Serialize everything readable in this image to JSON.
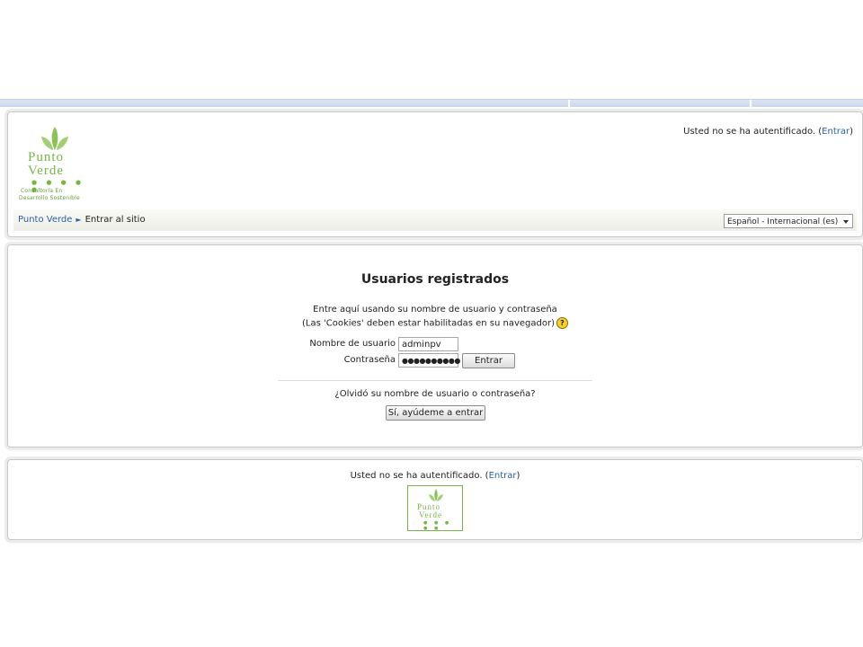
{
  "header": {
    "logo": {
      "word1": "Punto",
      "word2": "Verde",
      "dots": "● ● ● ● ●",
      "tagline1": "Consultoría En",
      "tagline2": "Desarrollo Sostenible"
    },
    "login_info": {
      "text": "Usted no se ha autentificado. (",
      "link": "Entrar",
      "suffix": ")"
    }
  },
  "navbar": {
    "breadcrumb": [
      {
        "label": "Punto Verde",
        "link": true
      },
      {
        "label": "Entrar al sitio",
        "link": false
      }
    ],
    "separator": "►",
    "language": {
      "selected": "Español - Internacional (es)"
    }
  },
  "login": {
    "title": "Usuarios registrados",
    "desc1": "Entre aquí usando su nombre de usuario y contraseña",
    "desc2": "(Las 'Cookies' deben estar habilitadas en su navegador)",
    "help_glyph": "?",
    "username_label": "Nombre de usuario",
    "username_value": "adminpv",
    "password_label": "Contraseña",
    "password_value": "●●●●●●●●●●",
    "submit_label": "Entrar",
    "forgot_text": "¿Olvidó su nombre de usuario o contraseña?",
    "forgot_button": "Sí, ayúdeme a entrar"
  },
  "footer": {
    "login_info": {
      "text": "Usted no se ha autentificado. (",
      "link": "Entrar",
      "suffix": ")"
    },
    "logo": {
      "word1": "Punto",
      "word2": "Verde",
      "dots": "● ● ● ● ●"
    }
  },
  "colors": {
    "accent_green": "#78b646",
    "link_blue": "#2a5fa3"
  },
  "icons": {
    "help": "help-icon",
    "dropdown": "chevron-down-icon",
    "leaves": "leaf-icon"
  }
}
